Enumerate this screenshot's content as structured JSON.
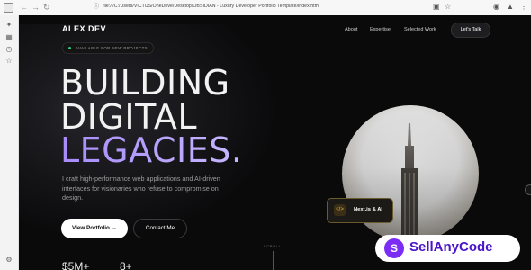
{
  "browser": {
    "address": "file:///C:/Users/VICTUS/OneDrive/Desktop/OBSIDIAN - Luxury Developer Portfolio Template/index.html",
    "back_icon": "arrow-left",
    "forward_icon": "arrow-right",
    "reload_icon": "reload"
  },
  "nav": {
    "brand": "ALEX DEV",
    "links": [
      "About",
      "Expertise",
      "Selected Work"
    ],
    "cta": "Let's Talk"
  },
  "hero": {
    "badge": "AVAILABLE FOR NEW PROJECTS",
    "line1": "BUILDING",
    "line2": "DIGITAL",
    "line3": "LEGACIES.",
    "lead": "I craft high-performance web applications and AI-driven interfaces for visionaries who refuse to compromise on design.",
    "primary_button": "View Portfolio →",
    "secondary_button": "Contact Me",
    "scroll_label": "SCROLL",
    "stat1": "$5M+",
    "stat2": "8+",
    "floating_card": "Next.js & AI",
    "floating_card_icon": "</>"
  },
  "watermark": {
    "logo": "S",
    "text": "SellAnyCode"
  },
  "colors": {
    "accent": "#a78bfa",
    "card_border": "#6b5a2d",
    "background": "#0a0a0b",
    "watermark": "#4b14c8"
  }
}
